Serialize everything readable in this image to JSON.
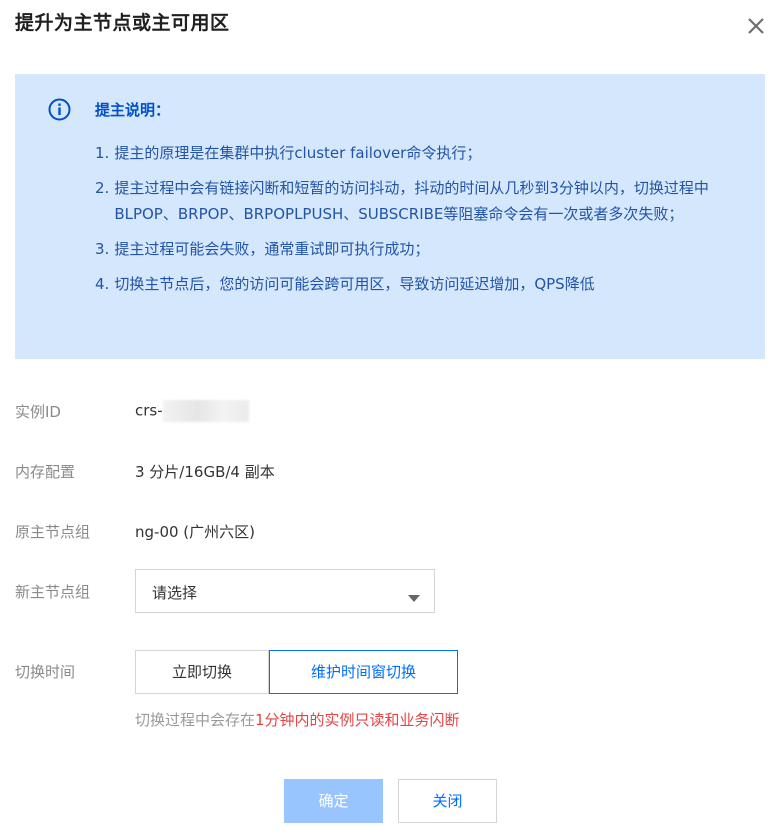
{
  "dialog": {
    "title": "提升为主节点或主可用区",
    "close_icon": "close-icon"
  },
  "notice": {
    "icon": "info-icon",
    "title": "提主说明：",
    "items": [
      {
        "num": "1.",
        "text": "提主的原理是在集群中执行cluster failover命令执行；"
      },
      {
        "num": "2.",
        "text": "提主过程中会有链接闪断和短暂的访问抖动，抖动的时间从几秒到3分钟以内，切换过程中BLPOP、BRPOP、BRPOPLPUSH、SUBSCRIBE等阻塞命令会有一次或者多次失败；"
      },
      {
        "num": "3.",
        "text": "提主过程可能会失败，通常重试即可执行成功；"
      },
      {
        "num": "4.",
        "text": "切换主节点后，您的访问可能会跨可用区，导致访问延迟增加，QPS降低"
      }
    ]
  },
  "form": {
    "instance_id": {
      "label": "实例ID",
      "value": "crs-"
    },
    "memory": {
      "label": "内存配置",
      "value": "3 分片/16GB/4 副本"
    },
    "original_group": {
      "label": "原主节点组",
      "value": "ng-00 (广州六区)"
    },
    "new_group": {
      "label": "新主节点组",
      "placeholder": "请选择"
    },
    "switch_time": {
      "label": "切换时间",
      "options": [
        "立即切换",
        "维护时间窗切换"
      ],
      "selected": "维护时间窗切换",
      "hint_prefix": "切换过程中会存在",
      "hint_warning": "1分钟内的实例只读和业务闪断"
    }
  },
  "footer": {
    "confirm_label": "确定",
    "close_label": "关闭"
  },
  "colors": {
    "accent": "#006eff",
    "notice_bg": "#d5e7fd",
    "notice_text": "#2154a6",
    "warning": "#e54545",
    "confirm_disabled": "#99c5ff"
  }
}
